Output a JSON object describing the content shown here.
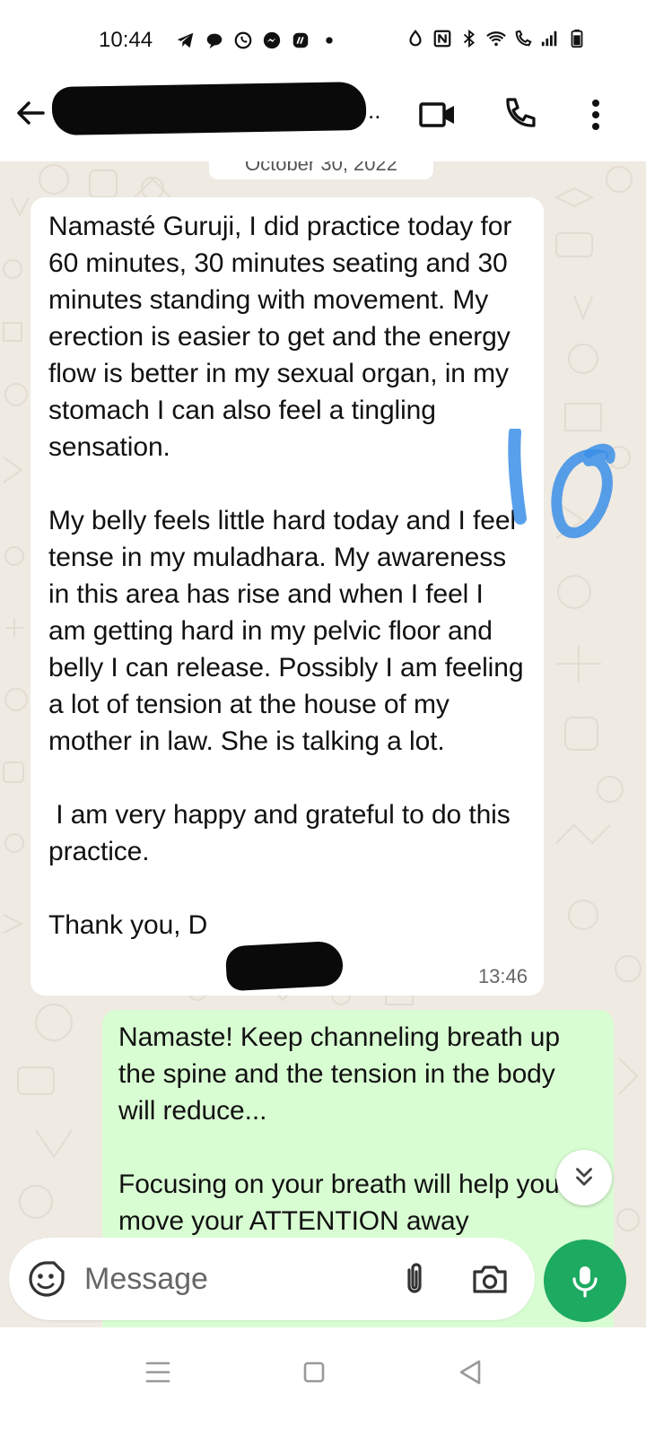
{
  "status_bar": {
    "time": "10:44",
    "left_icons": [
      "telegram-icon",
      "chat-bubble-icon",
      "whatsapp-icon",
      "messenger-icon",
      "app-icon",
      "dot-icon"
    ],
    "right_icons": [
      "data-saver-icon",
      "nfc-icon",
      "bluetooth-icon",
      "wifi-icon",
      "wifi-calling-icon",
      "signal-icon",
      "battery-icon"
    ]
  },
  "header": {
    "contact_suffix": "..",
    "back_icon": "arrow-left-icon",
    "video_icon": "video-call-icon",
    "call_icon": "phone-icon",
    "menu_icon": "more-vertical-icon"
  },
  "chat": {
    "date_chip": "October 30, 2022",
    "incoming": {
      "text": "Namasté Guruji, I did practice today for 60 minutes, 30 minutes seating and 30 minutes standing with movement. My erection is easier to get and the energy flow is better in my sexual organ, in my stomach I can also feel a tingling sensation.\n\nMy belly feels little hard today and I feel tense in my muladhara. My awareness in this area has rise and when I feel I am getting hard in my pelvic floor and belly I can release. Possibly I am feeling a lot of tension at the house of my mother in law. She is talking a lot.\n\n I am very happy and grateful to do this practice.\n\nThank you, D",
      "time": "13:46"
    },
    "outgoing": {
      "text": "Namaste! Keep channeling breath up the spine and the tension in the body will reduce...\n\nFocusing on your breath will help you move your ATTENTION away"
    },
    "annotation": "10",
    "scroll_icon": "double-chevron-down-icon"
  },
  "composer": {
    "placeholder": "Message",
    "emoji_icon": "sticker-emoji-icon",
    "attach_icon": "paperclip-icon",
    "camera_icon": "camera-icon",
    "mic_icon": "microphone-icon"
  },
  "navbar": {
    "icons": [
      "menu-icon",
      "home-square-icon",
      "back-triangle-icon"
    ]
  },
  "colors": {
    "chat_background": "#efeae2",
    "incoming_bubble": "#ffffff",
    "outgoing_bubble": "#d9fdd3",
    "mic_button": "#1daa61",
    "annotation_ink": "#3b8fe8"
  }
}
